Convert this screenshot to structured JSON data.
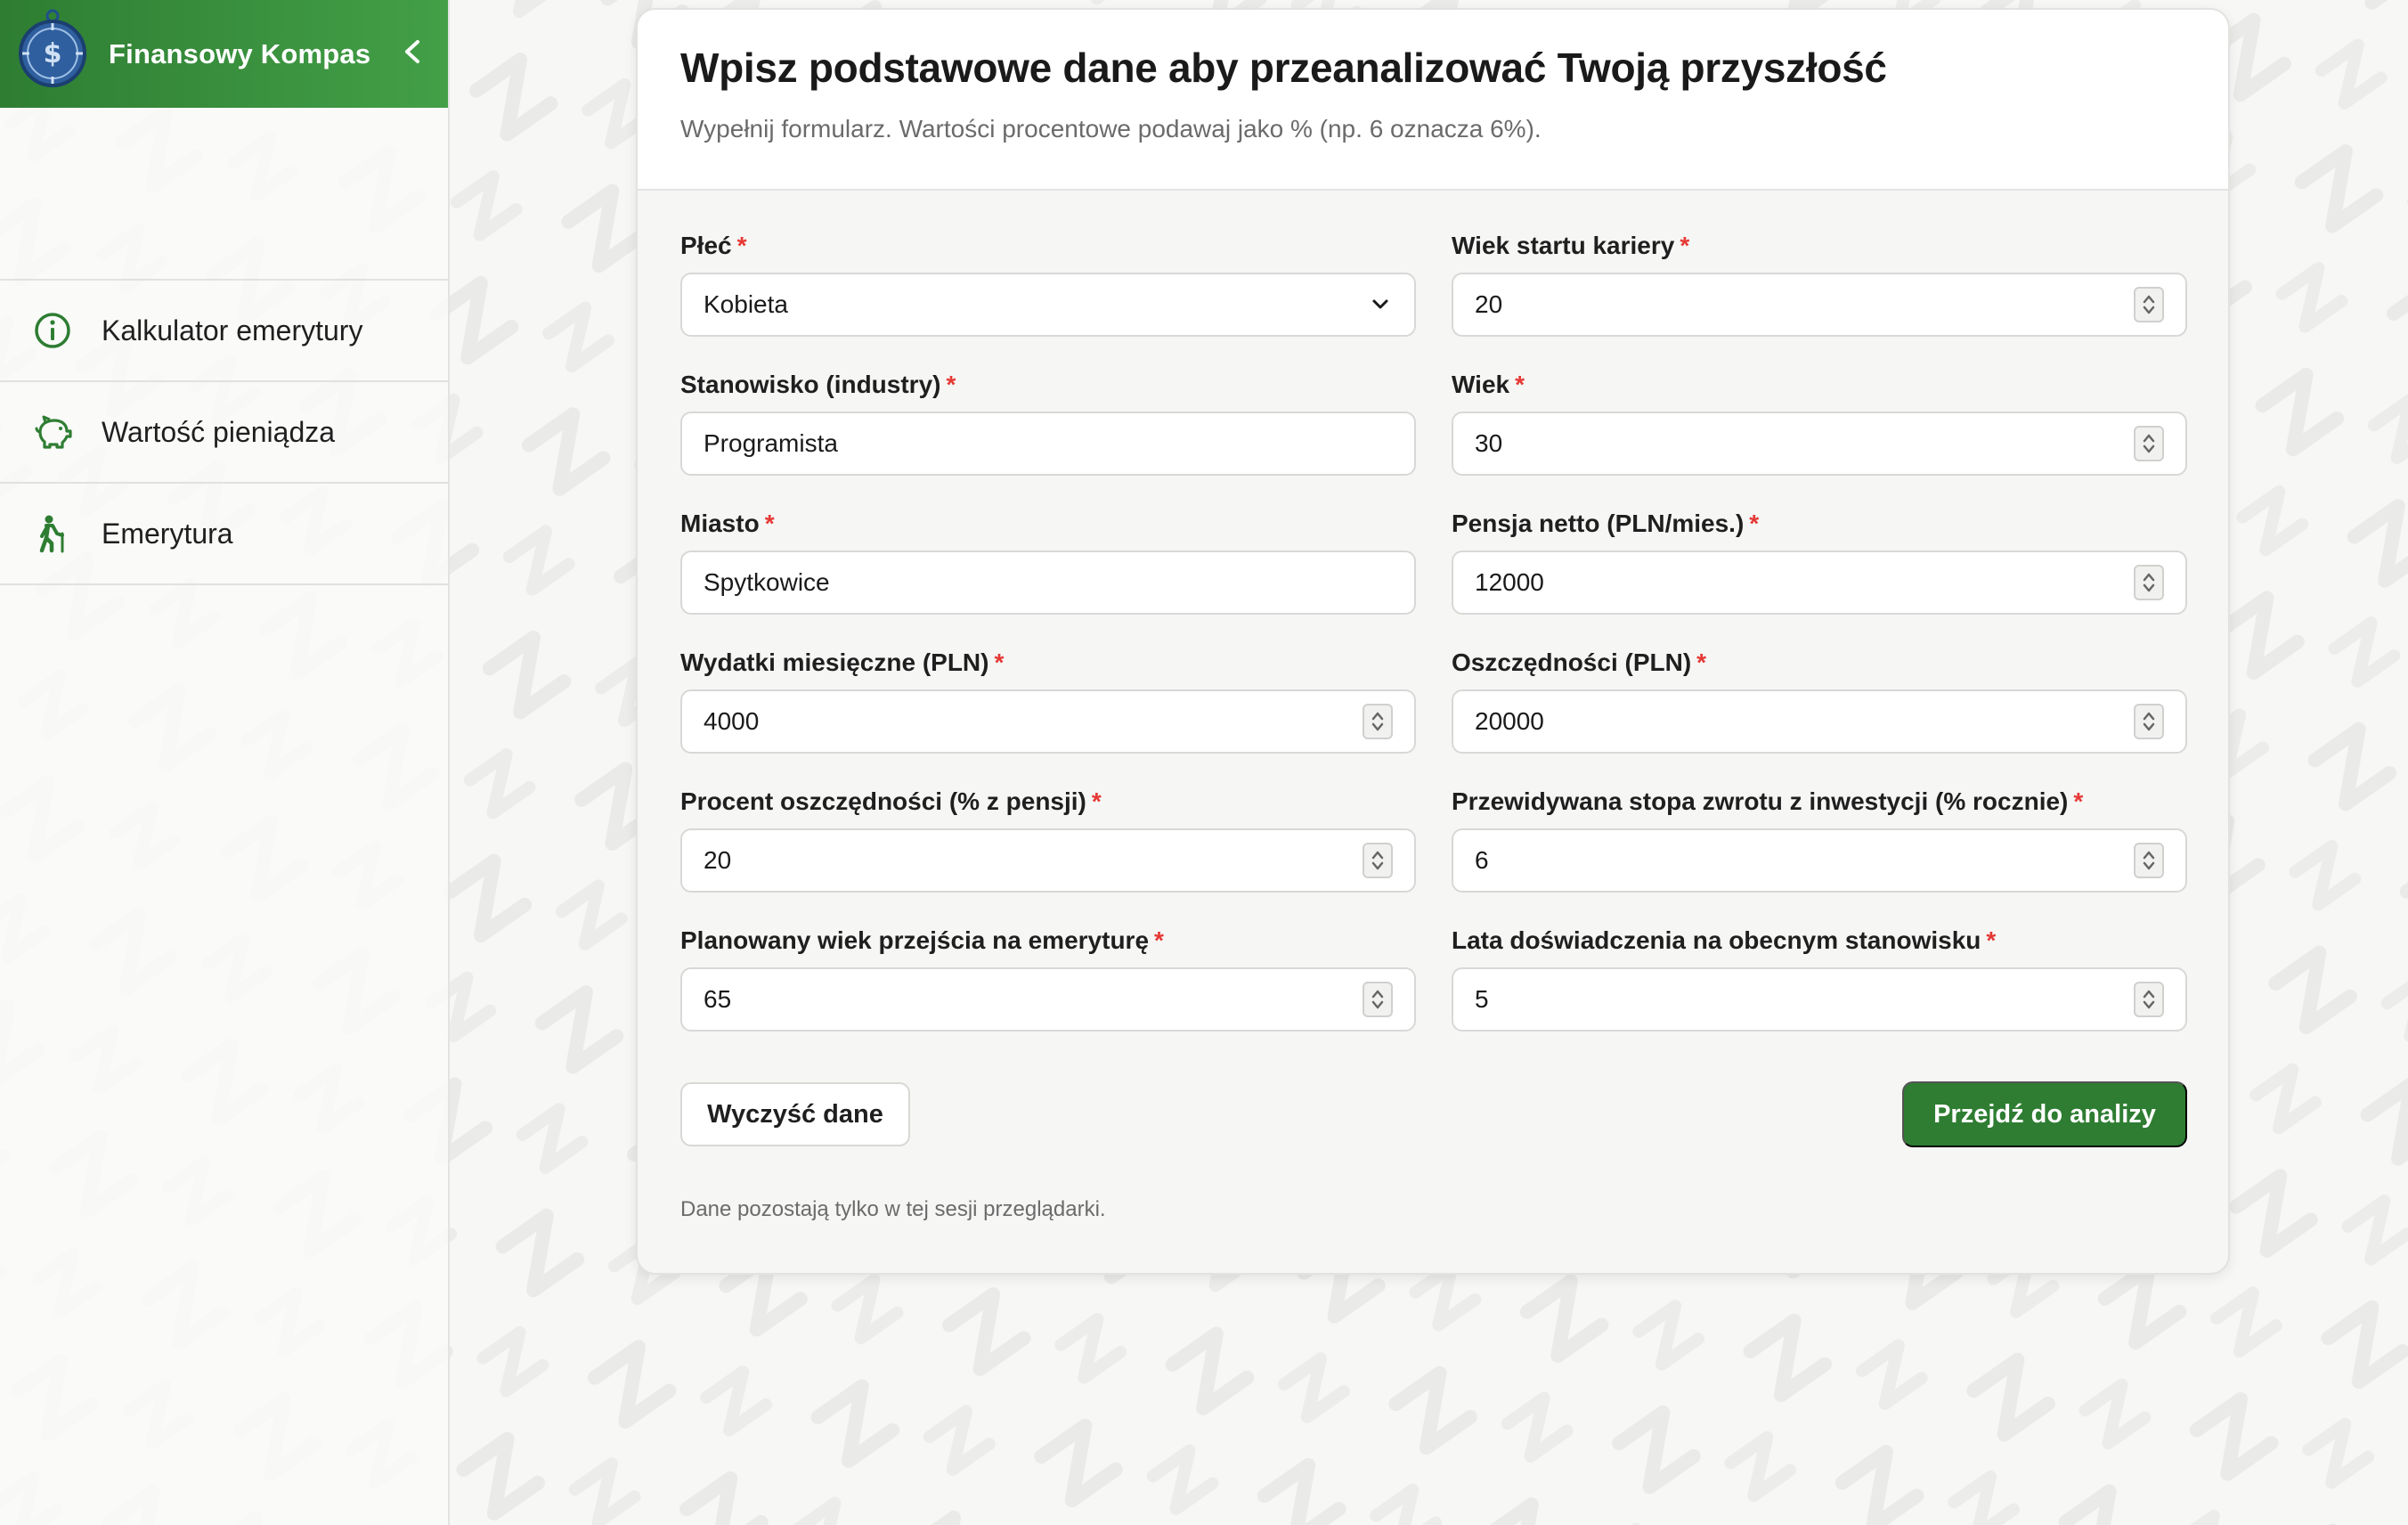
{
  "app": {
    "title": "Finansowy Kompas"
  },
  "sidebar": {
    "items": [
      {
        "label": "Kalkulator emerytury",
        "icon": "info-icon"
      },
      {
        "label": "Wartość pieniądza",
        "icon": "piggy-bank-icon"
      },
      {
        "label": "Emerytura",
        "icon": "walking-elder-icon"
      }
    ]
  },
  "form": {
    "title": "Wpisz podstawowe dane aby przeanalizować Twoją przyszłość",
    "subtitle": "Wypełnij formularz. Wartości procentowe podawaj jako % (np. 6 oznacza 6%).",
    "required_mark": "*",
    "fields": [
      {
        "label": "Płeć",
        "value": "Kobieta",
        "type": "select"
      },
      {
        "label": "Wiek startu kariery",
        "value": "20",
        "type": "number"
      },
      {
        "label": "Stanowisko (industry)",
        "value": "Programista",
        "type": "text"
      },
      {
        "label": "Wiek",
        "value": "30",
        "type": "number"
      },
      {
        "label": "Miasto",
        "value": "Spytkowice",
        "type": "text"
      },
      {
        "label": "Pensja netto (PLN/mies.)",
        "value": "12000",
        "type": "number"
      },
      {
        "label": "Wydatki miesięczne (PLN)",
        "value": "4000",
        "type": "number"
      },
      {
        "label": "Oszczędności (PLN)",
        "value": "20000",
        "type": "number"
      },
      {
        "label": "Procent oszczędności (% z pensji)",
        "value": "20",
        "type": "number"
      },
      {
        "label": "Przewidywana stopa zwrotu z inwestycji (% rocznie)",
        "value": "6",
        "type": "number"
      },
      {
        "label": "Planowany wiek przejścia na emeryturę",
        "value": "65",
        "type": "number"
      },
      {
        "label": "Lata doświadczenia na obecnym stanowisku",
        "value": "5",
        "type": "number"
      }
    ],
    "clear_label": "Wyczyść dane",
    "submit_label": "Przejdź do analizy",
    "footnote": "Dane pozostają tylko w tej sesji przeglądarki."
  },
  "colors": {
    "brand_green": "#2e7d32",
    "required_red": "#e53935"
  }
}
